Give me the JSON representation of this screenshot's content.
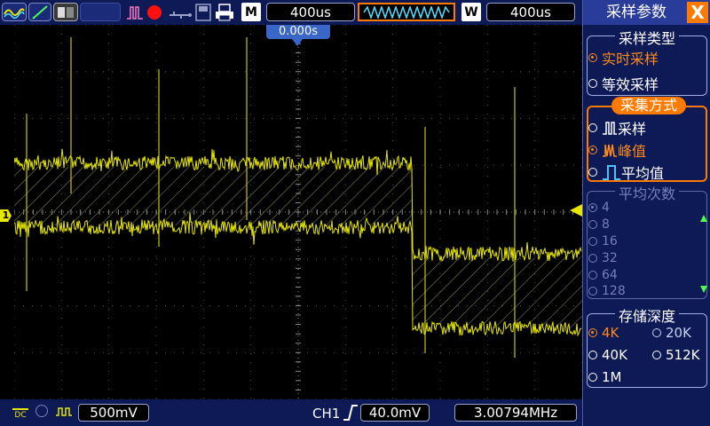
{
  "topbar": {
    "mode_label": "M",
    "main_timebase": "400us",
    "window_label": "W",
    "window_timebase": "400us",
    "trigger_time": "0.000s"
  },
  "bottombar": {
    "ch1_scale": "500mV",
    "trigger_channel": "CH1",
    "trigger_level": "40.0mV",
    "frequency": "3.00794MHz"
  },
  "panel": {
    "title": "采样参数",
    "close_label": "X",
    "sampling_type": {
      "title": "采样类型",
      "options": [
        {
          "label": "实时采样",
          "selected": true
        },
        {
          "label": "等效采样",
          "selected": false
        }
      ]
    },
    "acquire_mode": {
      "title": "采集方式",
      "options": [
        {
          "label": "采样",
          "selected": false
        },
        {
          "label": "峰值",
          "selected": true
        },
        {
          "label": "平均值",
          "selected": false
        }
      ]
    },
    "average_count": {
      "title": "平均次数",
      "options": [
        "4",
        "8",
        "16",
        "32",
        "64",
        "128"
      ]
    },
    "memory_depth": {
      "title": "存储深度",
      "options": [
        {
          "label": "4K",
          "selected": true
        },
        {
          "label": "20K",
          "selected": false
        },
        {
          "label": "40K",
          "selected": false
        },
        {
          "label": "512K",
          "selected": false
        },
        {
          "label": "1M",
          "selected": false
        }
      ]
    }
  },
  "channel_marker": "1",
  "colors": {
    "trace": "#e6e600",
    "accent": "#ff7a00",
    "bar": "#0d1a56",
    "grid": "#7a7a7a"
  }
}
